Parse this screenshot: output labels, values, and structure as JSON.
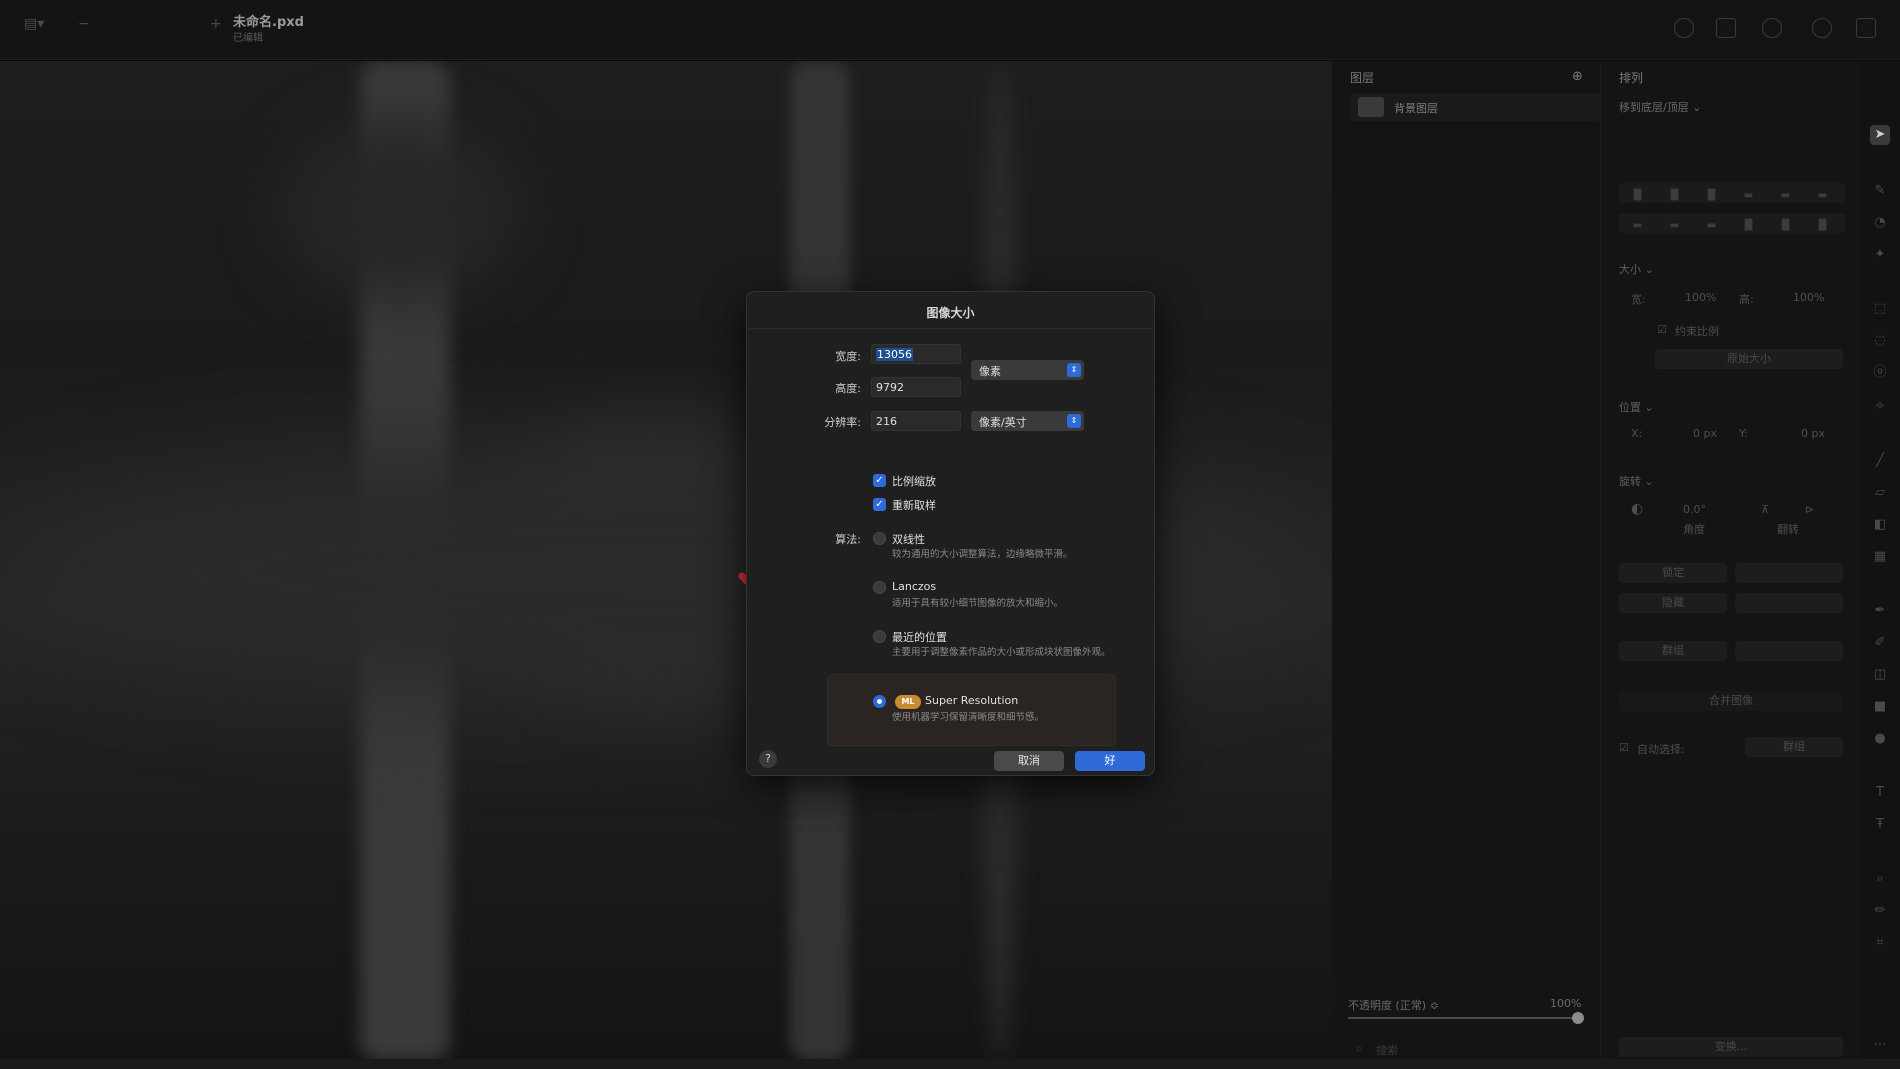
{
  "titlebar": {
    "doc_title": "未命名.pxd",
    "doc_subtitle": "已编辑"
  },
  "layers_panel": {
    "title": "图层",
    "layers": [
      {
        "name": "背景图层"
      }
    ],
    "opacity_label": "不透明度 (正常) ≎",
    "opacity_value": "100%",
    "search_placeholder": "搜索",
    "search_icon": "magnifier-icon"
  },
  "arrange_panel": {
    "title": "排列",
    "move_label": "移到底层/顶层 ⌄",
    "size_section": "大小 ⌄",
    "width_label": "宽:",
    "width_value": "100%",
    "height_label": "高:",
    "height_value": "100%",
    "constrain_label": "约束比例",
    "original_size_button": "原始大小",
    "position_section": "位置 ⌄",
    "x_label": "X:",
    "x_value": "0 px",
    "y_label": "Y:",
    "y_value": "0 px",
    "rotate_section": "旋转 ⌄",
    "rotate_value": "0.0°",
    "angle_label": "角度",
    "flip_label": "翻转",
    "lock_button": "锁定",
    "hide_button": "隐藏",
    "group_button": "群组",
    "merge_button": "合并图像",
    "auto_select_label": "自动选择:",
    "auto_select_value": "群组",
    "transform_button": "变换..."
  },
  "dialog": {
    "title": "图像大小",
    "width_label": "宽度:",
    "width_value": "13056",
    "height_label": "高度:",
    "height_value": "9792",
    "resolution_label": "分辨率:",
    "resolution_value": "216",
    "unit_popup": "像素",
    "resolution_unit_popup": "像素/英寸",
    "scale_proportionally": "比例缩放",
    "resample": "重新取样",
    "algorithm_label": "算法:",
    "algorithms": [
      {
        "name": "双线性",
        "desc": "较为通用的大小调整算法，边缘略微平滑。",
        "selected": false
      },
      {
        "name": "Lanczos",
        "desc": "适用于具有较小细节图像的放大和缩小。",
        "selected": false
      },
      {
        "name": "最近的位置",
        "desc": "主要用于调整像素作品的大小或形成块状图像外观。",
        "selected": false
      },
      {
        "name": "Super Resolution",
        "desc": "使用机器学习保留清晰度和细节感。",
        "selected": true,
        "badge": "ML"
      }
    ],
    "help_label": "?",
    "cancel_label": "取消",
    "ok_label": "好"
  },
  "colors": {
    "accent": "#2f6ad9",
    "ml_badge": "#c98b2e",
    "annotation_arrow": "#e8333a"
  }
}
